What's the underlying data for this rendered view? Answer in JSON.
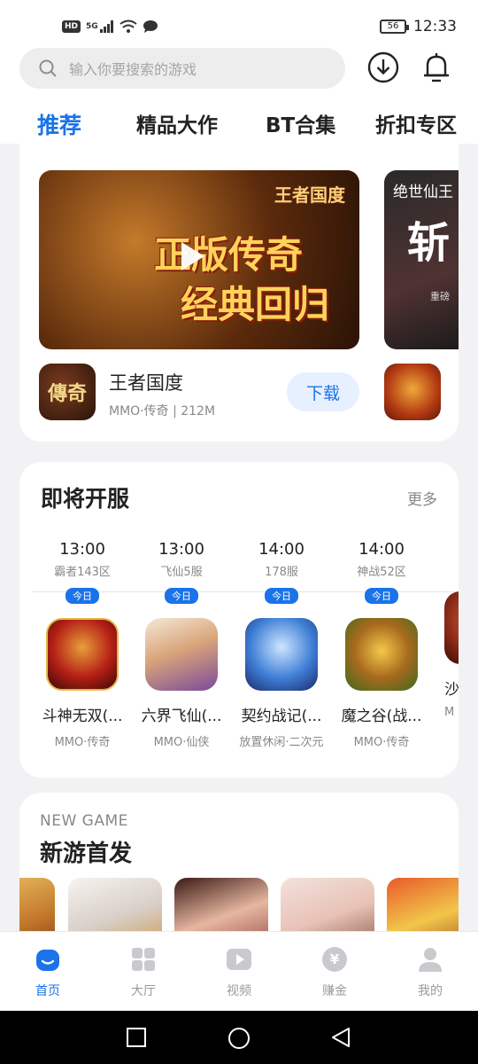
{
  "status_bar": {
    "hd": "HD",
    "signal": "5G",
    "battery": "56",
    "time": "12:33"
  },
  "search": {
    "placeholder": "输入你要搜索的游戏"
  },
  "tabs": [
    {
      "label": "推荐",
      "active": true
    },
    {
      "label": "精品大作",
      "active": false
    },
    {
      "label": "BT合集",
      "active": false
    },
    {
      "label": "折扣专区",
      "active": false
    }
  ],
  "featured": {
    "banner_title_line1": "正版传奇",
    "banner_title_line2": "经典回归",
    "banner_logo": "王者国度",
    "banner2_title_small": "绝世仙王",
    "banner2_title_big": "斩",
    "banner2_subtitle": "重磅",
    "game": {
      "icon_text": "傳奇",
      "name": "王者国度",
      "meta": "MMO·传奇 | 212M",
      "download_label": "下载"
    }
  },
  "upcoming": {
    "title": "即将开服",
    "more_label": "更多",
    "today_label": "今日",
    "items": [
      {
        "time": "13:00",
        "server": "霸者143区",
        "name": "斗神无双(...",
        "tags": "MMO·传奇",
        "icon_color": "#b51f15"
      },
      {
        "time": "13:00",
        "server": "飞仙5服",
        "name": "六界飞仙(...",
        "tags": "MMO·仙侠",
        "icon_color": "#d9a57a"
      },
      {
        "time": "14:00",
        "server": "178服",
        "name": "契约战记(...",
        "tags": "放置休闲·二次元",
        "icon_color": "#3f7fd6"
      },
      {
        "time": "14:00",
        "server": "神战52区",
        "name": "魔之谷(战...",
        "tags": "MMO·传奇",
        "icon_color": "#a86a1e"
      },
      {
        "time": "",
        "server": "",
        "name": "沙城",
        "tags": "M",
        "icon_color": "#8a2a18"
      }
    ]
  },
  "new_game": {
    "title_en": "NEW GAME",
    "title_cn": "新游首发"
  },
  "bottom_nav": [
    {
      "label": "首页",
      "icon": "home-icon",
      "active": true
    },
    {
      "label": "大厅",
      "icon": "grid-icon",
      "active": false
    },
    {
      "label": "视频",
      "icon": "video-icon",
      "active": false
    },
    {
      "label": "赚金",
      "icon": "coin-icon",
      "active": false
    },
    {
      "label": "我的",
      "icon": "profile-icon",
      "active": false
    }
  ],
  "colors": {
    "accent": "#1a73e8",
    "background": "#f2f2f4"
  }
}
